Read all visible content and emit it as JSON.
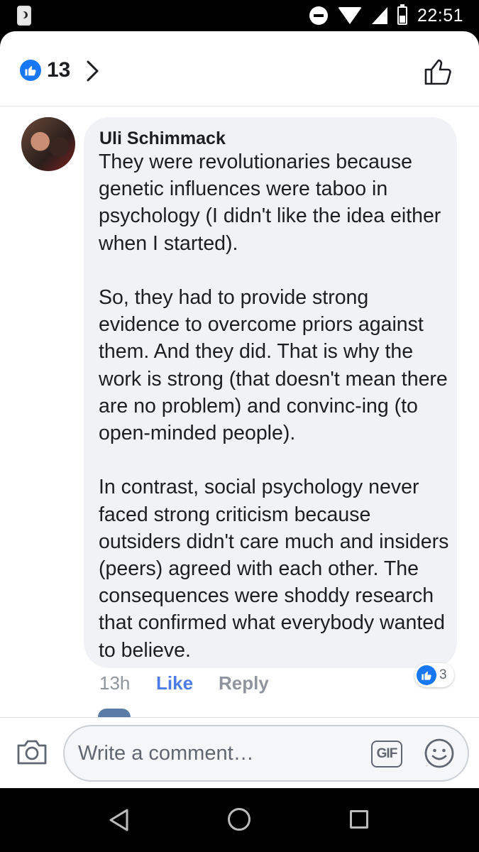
{
  "status_bar": {
    "time": "22:51",
    "icons": [
      "moon-notification-icon",
      "do-not-disturb-icon",
      "wifi-icon",
      "signal-icon",
      "battery-icon"
    ]
  },
  "reactions": {
    "count": "13",
    "icons": [
      "like-badge-icon",
      "chevron-right-icon",
      "like-outline-icon"
    ]
  },
  "comment": {
    "author": "Uli Schimmack",
    "text": "They were revolutionaries because genetic influences were taboo in psychology (I didn't like the idea either when I started).\n\nSo, they had to provide strong evidence to overcome priors against them.  And they did. That is why the work is strong (that doesn't mean there are no problem) and convinc-ing (to open-minded people).\n\nIn contrast, social psychology never faced strong criticism because outsiders didn't care much and insiders (peers) agreed with each other. The consequences were shoddy research that confirmed what everybody wanted to believe.",
    "timestamp": "13h",
    "like_label": "Like",
    "reply_label": "Reply",
    "reaction_count": "3"
  },
  "composer": {
    "placeholder": "Write a comment…",
    "gif_label": "GIF",
    "icons": [
      "camera-icon",
      "gif-icon",
      "emoji-icon"
    ]
  },
  "nav_bar": {
    "icons": [
      "back-icon",
      "home-icon",
      "recents-icon"
    ]
  },
  "colors": {
    "facebook_blue": "#1877f2",
    "link_blue": "#4b7be5",
    "bubble_gray": "#f0f2f5",
    "secondary_text": "#90949c"
  }
}
